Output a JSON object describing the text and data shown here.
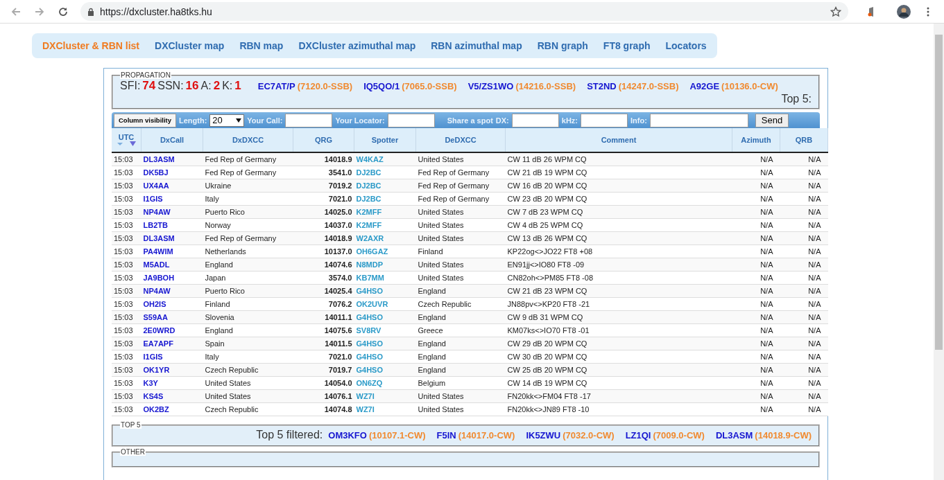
{
  "browser": {
    "url": "https://dxcluster.ha8tks.hu"
  },
  "nav": [
    {
      "label": "DXCluster & RBN list",
      "selected": true
    },
    {
      "label": "DXCluster map",
      "selected": false
    },
    {
      "label": "RBN map",
      "selected": false
    },
    {
      "label": "DXCluster azimuthal map",
      "selected": false
    },
    {
      "label": "RBN azimuthal map",
      "selected": false
    },
    {
      "label": "RBN graph",
      "selected": false
    },
    {
      "label": "FT8 graph",
      "selected": false
    },
    {
      "label": "Locators",
      "selected": false
    }
  ],
  "propagation": {
    "legend": "PROPAGATION",
    "indices": [
      {
        "label": "SFI:",
        "value": "74"
      },
      {
        "label": "SSN:",
        "value": "16"
      },
      {
        "label": "A:",
        "value": "2"
      },
      {
        "label": "K:",
        "value": "1"
      }
    ],
    "spots": [
      {
        "call": "EC7AT/P",
        "info": "(7120.0-SSB)"
      },
      {
        "call": "IQ5QO/1",
        "info": "(7065.0-SSB)"
      },
      {
        "call": "V5/ZS1WO",
        "info": "(14216.0-SSB)"
      },
      {
        "call": "ST2ND",
        "info": "(14247.0-SSB)"
      },
      {
        "call": "A92GE",
        "info": "(10136.0-CW)"
      }
    ],
    "top_label": "Top 5:"
  },
  "toolbar": {
    "column_visibility": "Column visibility",
    "length_label": "Length:",
    "length_value": "20",
    "your_call_label": "Your Call:",
    "your_locator_label": "Your Locator:",
    "share_label": "Share a spot",
    "dx_label": "DX:",
    "khz_label": "kHz:",
    "info_label": "Info:",
    "send": "Send"
  },
  "table": {
    "columns": [
      "UTC",
      "DxCall",
      "DxDXCC",
      "QRG",
      "Spotter",
      "DeDXCC",
      "Comment",
      "Azimuth",
      "QRB"
    ],
    "rows": [
      [
        "15:03",
        "DL3ASM",
        "Fed Rep of Germany",
        "14018.9",
        "W4KAZ",
        "United States",
        "CW 11 dB 26 WPM CQ",
        "N/A",
        "N/A"
      ],
      [
        "15:03",
        "DK5BJ",
        "Fed Rep of Germany",
        "3541.0",
        "DJ2BC",
        "Fed Rep of Germany",
        "CW 21 dB 19 WPM CQ",
        "N/A",
        "N/A"
      ],
      [
        "15:03",
        "UX4AA",
        "Ukraine",
        "7019.2",
        "DJ2BC",
        "Fed Rep of Germany",
        "CW 16 dB 20 WPM CQ",
        "N/A",
        "N/A"
      ],
      [
        "15:03",
        "I1GIS",
        "Italy",
        "7021.0",
        "DJ2BC",
        "Fed Rep of Germany",
        "CW 23 dB 20 WPM CQ",
        "N/A",
        "N/A"
      ],
      [
        "15:03",
        "NP4AW",
        "Puerto Rico",
        "14025.0",
        "K2MFF",
        "United States",
        "CW 7 dB 23 WPM CQ",
        "N/A",
        "N/A"
      ],
      [
        "15:03",
        "LB2TB",
        "Norway",
        "14037.0",
        "K2MFF",
        "United States",
        "CW 4 dB 25 WPM CQ",
        "N/A",
        "N/A"
      ],
      [
        "15:03",
        "DL3ASM",
        "Fed Rep of Germany",
        "14018.9",
        "W2AXR",
        "United States",
        "CW 13 dB 26 WPM CQ",
        "N/A",
        "N/A"
      ],
      [
        "15:03",
        "PA4WIM",
        "Netherlands",
        "10137.0",
        "OH6GAZ",
        "Finland",
        "KP22og<>JO22 FT8 +08",
        "N/A",
        "N/A"
      ],
      [
        "15:03",
        "M5ADL",
        "England",
        "14074.6",
        "N8MDP",
        "United States",
        "EN91jj<>IO80 FT8 -09",
        "N/A",
        "N/A"
      ],
      [
        "15:03",
        "JA9BOH",
        "Japan",
        "3574.0",
        "KB7MM",
        "United States",
        "CN82oh<>PM85 FT8 -08",
        "N/A",
        "N/A"
      ],
      [
        "15:03",
        "NP4AW",
        "Puerto Rico",
        "14025.4",
        "G4HSO",
        "England",
        "CW 21 dB 23 WPM CQ",
        "N/A",
        "N/A"
      ],
      [
        "15:03",
        "OH2IS",
        "Finland",
        "7076.2",
        "OK2UVR",
        "Czech Republic",
        "JN88pv<>KP20 FT8 -21",
        "N/A",
        "N/A"
      ],
      [
        "15:03",
        "S59AA",
        "Slovenia",
        "14011.1",
        "G4HSO",
        "England",
        "CW 9 dB 31 WPM CQ",
        "N/A",
        "N/A"
      ],
      [
        "15:03",
        "2E0WRD",
        "England",
        "14075.6",
        "SV8RV",
        "Greece",
        "KM07ks<>IO70 FT8 -01",
        "N/A",
        "N/A"
      ],
      [
        "15:03",
        "EA7APF",
        "Spain",
        "14011.5",
        "G4HSO",
        "England",
        "CW 29 dB 20 WPM CQ",
        "N/A",
        "N/A"
      ],
      [
        "15:03",
        "I1GIS",
        "Italy",
        "7021.0",
        "G4HSO",
        "England",
        "CW 30 dB 20 WPM CQ",
        "N/A",
        "N/A"
      ],
      [
        "15:03",
        "OK1YR",
        "Czech Republic",
        "7019.7",
        "G4HSO",
        "England",
        "CW 25 dB 20 WPM CQ",
        "N/A",
        "N/A"
      ],
      [
        "15:03",
        "K3Y",
        "United States",
        "14054.0",
        "ON6ZQ",
        "Belgium",
        "CW 14 dB 19 WPM CQ",
        "N/A",
        "N/A"
      ],
      [
        "15:03",
        "KS4S",
        "United States",
        "14076.1",
        "WZ7I",
        "United States",
        "FN20kk<>FM04 FT8 -17",
        "N/A",
        "N/A"
      ],
      [
        "15:03",
        "OK2BZ",
        "Czech Republic",
        "14074.8",
        "WZ7I",
        "United States",
        "FN20kk<>JN89 FT8 -10",
        "N/A",
        "N/A"
      ]
    ]
  },
  "top5": {
    "legend": "TOP 5",
    "label": "Top 5 filtered:",
    "spots": [
      {
        "call": "OM3KFO",
        "info": "(10107.1-CW)"
      },
      {
        "call": "F5IN",
        "info": "(14017.0-CW)"
      },
      {
        "call": "IK5ZWU",
        "info": "(7032.0-CW)"
      },
      {
        "call": "LZ1QI",
        "info": "(7009.0-CW)"
      },
      {
        "call": "DL3ASM",
        "info": "(14018.9-CW)"
      }
    ]
  },
  "other": {
    "legend": "OTHER"
  }
}
